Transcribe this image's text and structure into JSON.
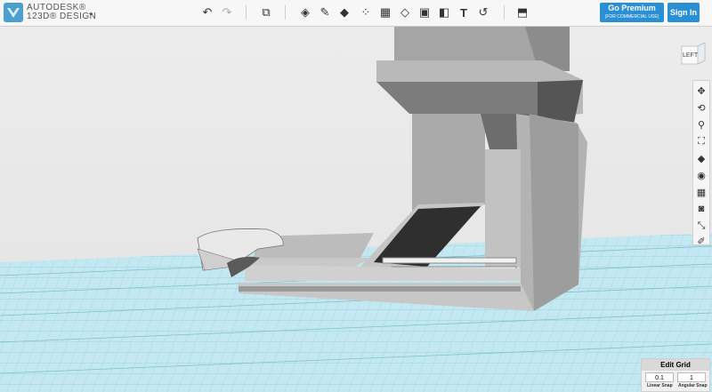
{
  "app": {
    "brand_line1": "AUTODESK®",
    "brand_line2": "123D® DESIGN",
    "brand_menu_icon": "chevron-down-icon"
  },
  "toolbar": {
    "tools": [
      {
        "name": "undo-icon",
        "glyph": "↶"
      },
      {
        "name": "redo-icon",
        "glyph": "↷"
      },
      {
        "name": "transform-icon",
        "glyph": "⧉"
      },
      {
        "name": "primitives-icon",
        "glyph": "◈"
      },
      {
        "name": "sketch-icon",
        "glyph": "✎"
      },
      {
        "name": "construct-icon",
        "glyph": "◆"
      },
      {
        "name": "modify-icon",
        "glyph": "⁘"
      },
      {
        "name": "pattern-icon",
        "glyph": "◇"
      },
      {
        "name": "group-icon",
        "glyph": "▣"
      },
      {
        "name": "combine-icon",
        "glyph": "◧"
      },
      {
        "name": "text-icon",
        "glyph": "T"
      },
      {
        "name": "snap-icon",
        "glyph": "↺"
      },
      {
        "name": "material-icon",
        "glyph": "⬒"
      }
    ],
    "premium_label": "Go Premium",
    "premium_sub": "(FOR COMMERCIAL USE)",
    "signin_label": "Sign In"
  },
  "viewcube": {
    "face_label": "LEFT"
  },
  "nav_tools": [
    {
      "name": "pan-icon",
      "glyph": "✥"
    },
    {
      "name": "orbit-icon",
      "glyph": "⟲"
    },
    {
      "name": "zoom-icon",
      "glyph": "⚲"
    },
    {
      "name": "fit-icon",
      "glyph": "⛶"
    },
    {
      "name": "view-style-icon",
      "glyph": "◆"
    },
    {
      "name": "visibility-icon",
      "glyph": "◉"
    },
    {
      "name": "grid-toggle-icon",
      "glyph": "▦"
    },
    {
      "name": "camera-icon",
      "glyph": "◙"
    },
    {
      "name": "measure-icon",
      "glyph": "⤡"
    },
    {
      "name": "material-tool-icon",
      "glyph": "✐"
    }
  ],
  "grid_panel": {
    "title": "Edit Grid",
    "linear_snap_value": "0.1",
    "angular_snap_value": "1",
    "linear_snap_label": "Linear Snap",
    "angular_snap_label": "Angular Snap"
  },
  "colors": {
    "accent": "#2a8fd3",
    "grid_bg": "#bfe6ef",
    "grid_line": "#7cc3d6",
    "model_gray": "#a9a9a9"
  }
}
